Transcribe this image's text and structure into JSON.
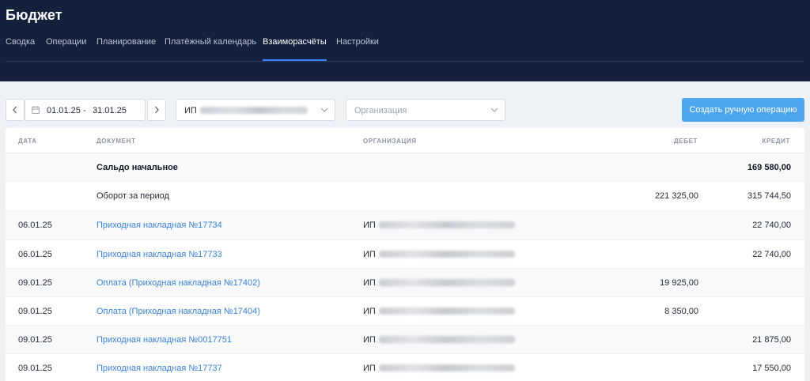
{
  "app": {
    "title": "Бюджет"
  },
  "tabs": [
    {
      "label": "Сводка",
      "active": false
    },
    {
      "label": "Операции",
      "active": false
    },
    {
      "label": "Планирование",
      "active": false
    },
    {
      "label": "Платёжный календарь",
      "active": false
    },
    {
      "label": "Взаиморасчёты",
      "active": true
    },
    {
      "label": "Настройки",
      "active": false
    }
  ],
  "filters": {
    "date_from": "01.01.25",
    "date_sep": "-",
    "date_to": "31.01.25",
    "counterparty_prefix": "ИП",
    "organization_placeholder": "Организация",
    "create_button": "Создать ручную операцию"
  },
  "table": {
    "headers": {
      "date": "Дата",
      "document": "Документ",
      "organization": "Организация",
      "debit": "Дебет",
      "credit": "Кредит"
    },
    "summary": [
      {
        "document": "Сальдо начальное",
        "debit": "",
        "credit": "169 580,00"
      },
      {
        "document": "Оборот за период",
        "debit": "221 325,00",
        "credit": "315 744,50"
      }
    ],
    "rows": [
      {
        "date": "06.01.25",
        "document": "Приходная накладная №17734",
        "org_prefix": "ИП",
        "debit": "",
        "credit": "22 740,00"
      },
      {
        "date": "06.01.25",
        "document": "Приходная накладная №17733",
        "org_prefix": "ИП",
        "debit": "",
        "credit": "22 740,00"
      },
      {
        "date": "09.01.25",
        "document": "Оплата (Приходная накладная №17402)",
        "org_prefix": "ИП",
        "debit": "19 925,00",
        "credit": ""
      },
      {
        "date": "09.01.25",
        "document": "Оплата (Приходная накладная №17404)",
        "org_prefix": "ИП",
        "debit": "8 350,00",
        "credit": ""
      },
      {
        "date": "09.01.25",
        "document": "Приходная накладная №0017751",
        "org_prefix": "ИП",
        "debit": "",
        "credit": "21 875,00"
      },
      {
        "date": "09.01.25",
        "document": "Приходная накладная №17737",
        "org_prefix": "ИП",
        "debit": "",
        "credit": "17 550,00"
      }
    ]
  },
  "colors": {
    "header_bg": "#14213d",
    "accent": "#3b82f6",
    "button": "#4ea6f0",
    "link": "#3b82d6"
  },
  "icons": {
    "prev": "chevron-left-icon",
    "next": "chevron-right-icon",
    "calendar": "calendar-icon",
    "dropdown": "chevron-down-icon"
  }
}
